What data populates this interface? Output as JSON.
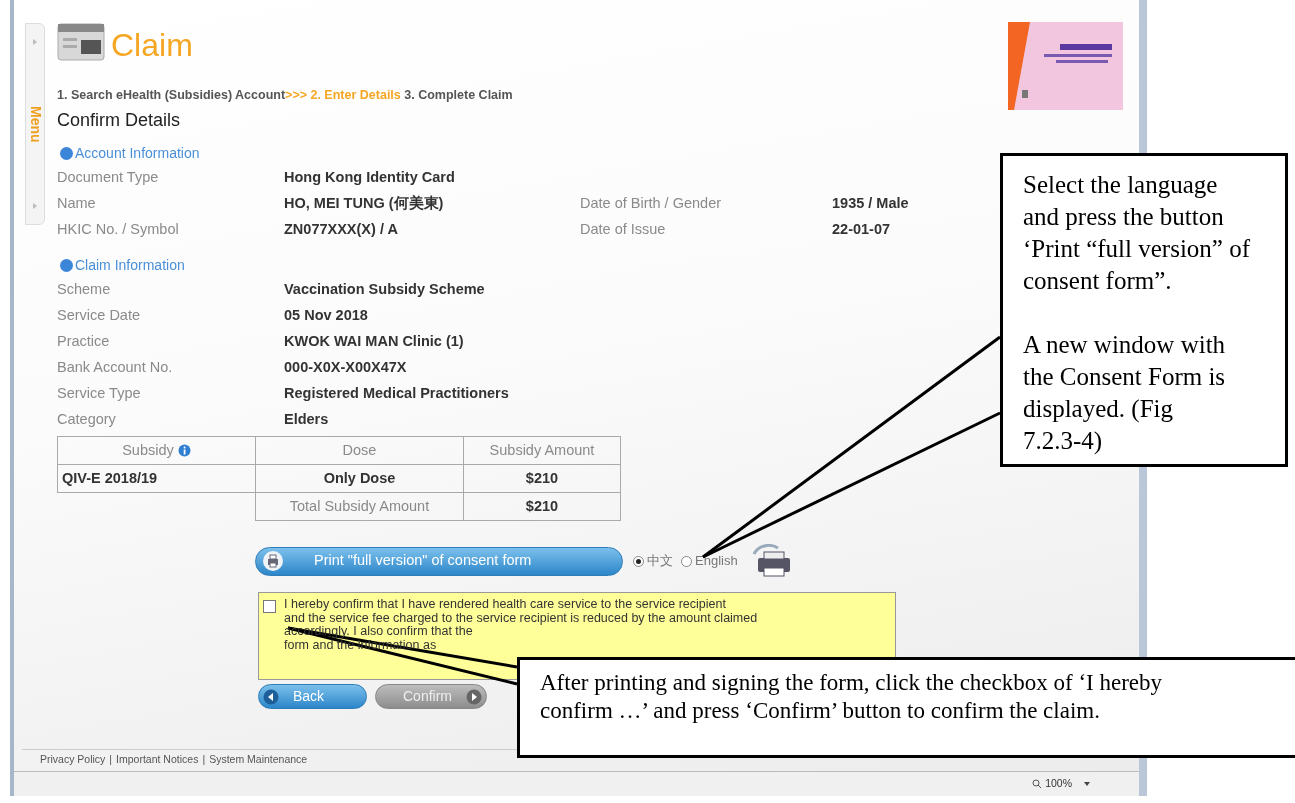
{
  "menu_tab": {
    "label": "Menu"
  },
  "title": "Claim",
  "steps": [
    {
      "kind": "step",
      "label": "1. Search eHealth (Subsidies) Account",
      "current": false
    },
    {
      "kind": "separator",
      "label": ">>>",
      "current": true
    },
    {
      "kind": "step",
      "label": "2. Enter Details",
      "current": true
    },
    {
      "kind": "step",
      "label": "3. Complete Claim",
      "current": false
    }
  ],
  "heading": "Confirm Details",
  "sections": [
    {
      "title": "Account Information",
      "rows": [
        {
          "label": "Document Type",
          "value": "Hong Kong Identity Card"
        },
        {
          "label": "Name",
          "value": "HO, MEI TUNG (何美東)",
          "label_2": "Date of Birth / Gender",
          "value_2": "1935 / Male"
        },
        {
          "label": "HKIC No. / Symbol",
          "value": "ZN077XXX(X) / A",
          "label_2": "Date of Issue",
          "value_2": "22-01-07"
        }
      ]
    },
    {
      "title": "Claim Information",
      "rows": [
        {
          "label": "Scheme",
          "value": "Vaccination Subsidy Scheme"
        },
        {
          "label": "Service Date",
          "value": "05 Nov 2018"
        },
        {
          "label": "Practice",
          "value": "KWOK WAI MAN Clinic (1)"
        },
        {
          "label": "Bank Account No.",
          "value": "000-X0X-X00X47X"
        },
        {
          "label": "Service Type",
          "value": "Registered Medical Practitioners"
        },
        {
          "label": "Category",
          "value": "Elders"
        }
      ]
    }
  ],
  "subsidy_table": {
    "columns": [
      {
        "label": "Subsidy",
        "info": true
      },
      {
        "label": "Dose",
        "info": false
      },
      {
        "label": "Subsidy Amount",
        "info": false
      }
    ],
    "rows": [
      [
        "QIV-E 2018/19",
        "Only Dose",
        "$210"
      ]
    ],
    "total": {
      "label": "Total Subsidy Amount",
      "value": "$210"
    }
  },
  "print_button": {
    "label": "Print \"full version\" of consent form"
  },
  "languages": [
    {
      "label": "中文",
      "selected": true
    },
    {
      "label": "English",
      "selected": false
    }
  ],
  "declaration": {
    "checked": false,
    "lines": [
      "I hereby confirm that I have rendered health care service to the service recipient",
      "and the service fee charged to the service recipient is reduced by the amount claimed",
      "accordingly. I also confirm that the",
      "form and the information as"
    ]
  },
  "buttons": [
    {
      "kind": "back",
      "label": "Back",
      "disabled": false
    },
    {
      "kind": "forward",
      "label": "Confirm",
      "disabled": true
    }
  ],
  "footer_links": [
    "Privacy Policy",
    "Important Notices",
    "System Maintenance"
  ],
  "footer_separator": "|",
  "status_bar": {
    "zoom": "100%"
  },
  "callouts": [
    {
      "paragraphs": [
        [
          "Select the language",
          "and press the button",
          "‘Print “full version” of",
          "consent form”."
        ],
        [
          "A new window with",
          "the Consent Form is",
          "displayed. (Fig",
          "7.2.3-4)"
        ]
      ]
    },
    {
      "paragraphs": [
        [
          "After printing and signing the form, click the checkbox of ‘I hereby",
          "confirm …’ and press ‘Confirm’ button to confirm the claim."
        ]
      ]
    }
  ]
}
